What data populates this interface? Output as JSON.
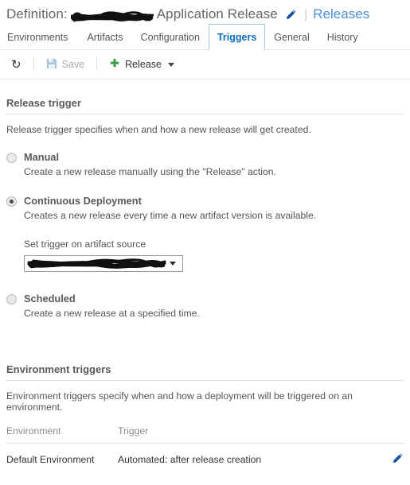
{
  "header": {
    "definition_prefix": "Definition:",
    "definition_name_redacted": true,
    "definition_suffix": "Application Release",
    "edit_icon": "pencil-icon",
    "separator": "|",
    "releases_link": "Releases",
    "link_color": "#4a90d9"
  },
  "tabs": [
    {
      "label": "Environments",
      "active": false
    },
    {
      "label": "Artifacts",
      "active": false
    },
    {
      "label": "Configuration",
      "active": false
    },
    {
      "label": "Triggers",
      "active": true
    },
    {
      "label": "General",
      "active": false
    },
    {
      "label": "History",
      "active": false
    }
  ],
  "toolbar": {
    "refresh_icon": "refresh-icon",
    "refresh_glyph": "↻",
    "save_label": "Save",
    "save_icon": "save-floppy-icon",
    "save_disabled": true,
    "release_label": "Release",
    "release_icon": "plus-icon",
    "release_has_dropdown": true,
    "plus_color": "#3a9d46"
  },
  "release_trigger": {
    "section_title": "Release trigger",
    "description": "Release trigger specifies when and how a new release will get created.",
    "options": [
      {
        "label": "Manual",
        "description": "Create a new release manually using the \"Release\" action.",
        "selected": false
      },
      {
        "label": "Continuous Deployment",
        "description": "Creates a new release every time a new artifact version is available.",
        "selected": true
      },
      {
        "label": "Scheduled",
        "description": "Create a new release at a specified time.",
        "selected": false
      }
    ],
    "artifact_source": {
      "label": "Set trigger on artifact source",
      "value_redacted": true,
      "dropdown_arrow": "chevron-down-icon"
    }
  },
  "environment_triggers": {
    "section_title": "Environment triggers",
    "description": "Environment triggers specify when and how a deployment will be triggered on an environment.",
    "columns": [
      "Environment",
      "Trigger",
      ""
    ],
    "rows": [
      {
        "environment": "Default Environment",
        "trigger": "Automated: after release creation",
        "edit_icon": "pencil-icon"
      }
    ]
  }
}
